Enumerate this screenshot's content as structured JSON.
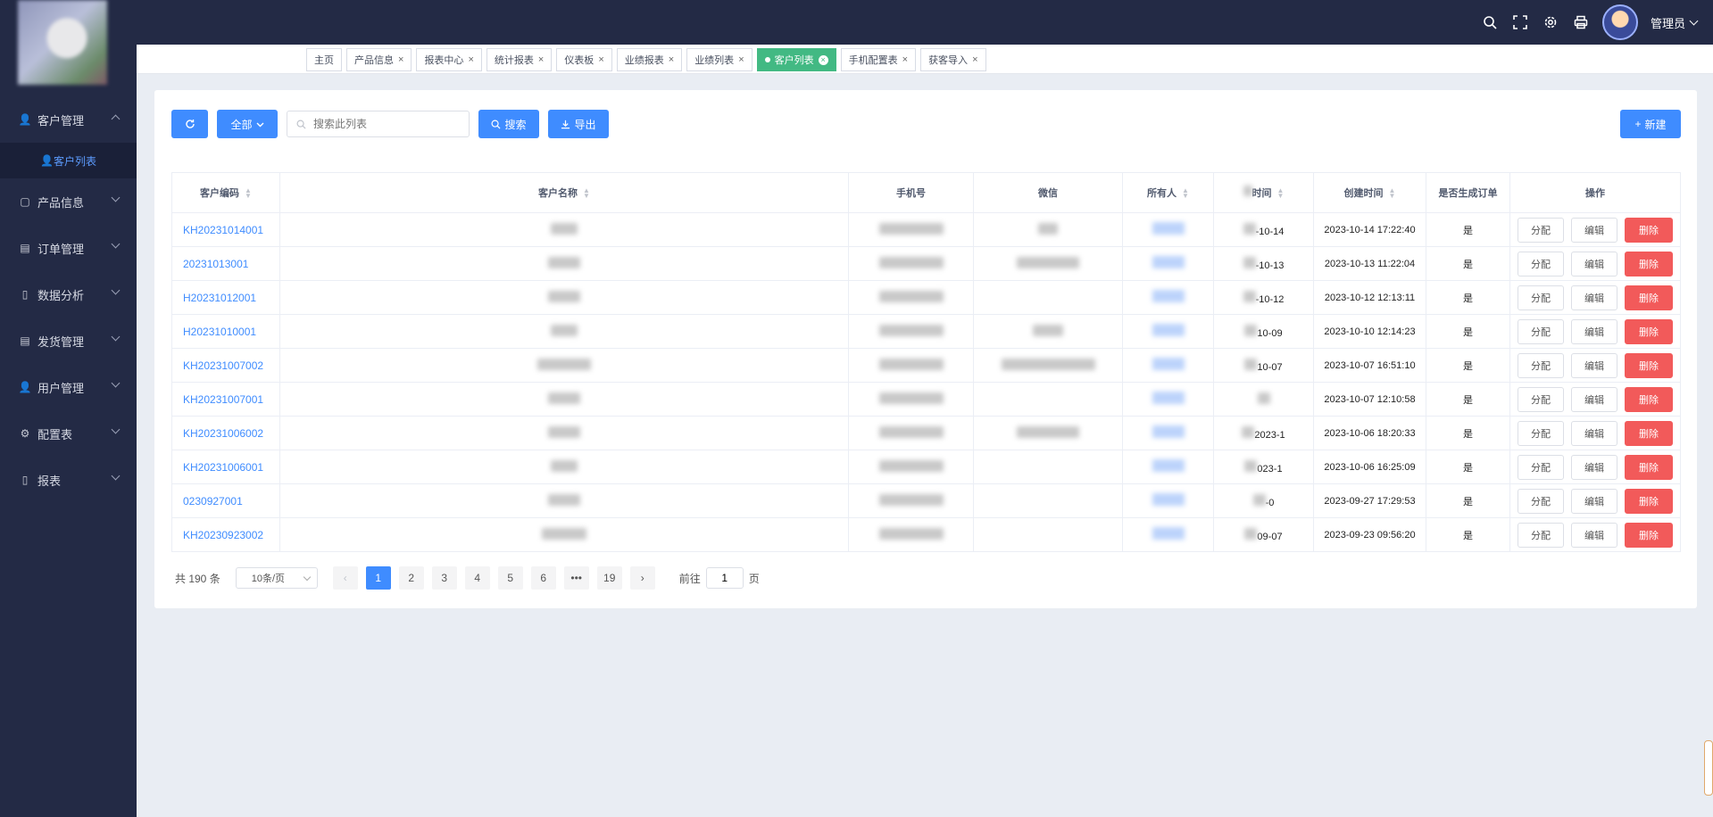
{
  "sidebar": {
    "items": [
      {
        "label": "客户管理",
        "icon": "user-icon",
        "expanded": true
      },
      {
        "label": "产品信息",
        "icon": "product-icon"
      },
      {
        "label": "订单管理",
        "icon": "clipboard-icon"
      },
      {
        "label": "数据分析",
        "icon": "chart-icon"
      },
      {
        "label": "发货管理",
        "icon": "clipboard-icon"
      },
      {
        "label": "用户管理",
        "icon": "user-icon"
      },
      {
        "label": "配置表",
        "icon": "gear-icon"
      },
      {
        "label": "报表",
        "icon": "chart-icon"
      }
    ],
    "sub_item": "客户列表"
  },
  "header": {
    "user": "管理员"
  },
  "tabs": [
    {
      "label": "主页",
      "closable": false
    },
    {
      "label": "产品信息",
      "closable": true
    },
    {
      "label": "报表中心",
      "closable": true
    },
    {
      "label": "统计报表",
      "closable": true
    },
    {
      "label": "仪表板",
      "closable": true
    },
    {
      "label": "业绩报表",
      "closable": true
    },
    {
      "label": "业绩列表",
      "closable": true
    },
    {
      "label": "客户列表",
      "closable": true,
      "active": true
    },
    {
      "label": "手机配置表",
      "closable": true
    },
    {
      "label": "获客导入",
      "closable": true
    }
  ],
  "toolbar": {
    "all_label": "全部",
    "search_placeholder": "搜索此列表",
    "search_label": "搜索",
    "export_label": "导出",
    "new_label": "新建"
  },
  "table": {
    "columns": [
      "客户编码",
      "客户名称",
      "手机号",
      "微信",
      "所有人",
      "时间",
      "创建时间",
      "是否生成订单",
      "操作"
    ],
    "rows": [
      {
        "code": "KH20231014001",
        "follow": "-10-14",
        "created": "2023-10-14 17:22:40",
        "order": "是"
      },
      {
        "code": "20231013001",
        "follow": "-10-13",
        "created": "2023-10-13 11:22:04",
        "order": "是"
      },
      {
        "code": "H20231012001",
        "follow": "-10-12",
        "created": "2023-10-12 12:13:11",
        "order": "是"
      },
      {
        "code": "H20231010001",
        "follow": "10-09",
        "created": "2023-10-10 12:14:23",
        "order": "是"
      },
      {
        "code": "KH20231007002",
        "follow": "10-07",
        "created": "2023-10-07 16:51:10",
        "order": "是"
      },
      {
        "code": "KH20231007001",
        "follow": "",
        "created": "2023-10-07 12:10:58",
        "order": "是"
      },
      {
        "code": "KH20231006002",
        "follow": "2023-1",
        "created": "2023-10-06 18:20:33",
        "order": "是"
      },
      {
        "code": "KH20231006001",
        "follow": "023-1",
        "created": "2023-10-06 16:25:09",
        "order": "是"
      },
      {
        "code": "0230927001",
        "follow": "-0",
        "created": "2023-09-27 17:29:53",
        "order": "是"
      },
      {
        "code": "KH20230923002",
        "follow": "09-07",
        "created": "2023-09-23 09:56:20",
        "order": "是"
      }
    ],
    "actions": {
      "assign": "分配",
      "edit": "编辑",
      "delete": "删除"
    }
  },
  "pagination": {
    "total_text": "共 190 条",
    "page_size": "10条/页",
    "pages": [
      "1",
      "2",
      "3",
      "4",
      "5",
      "6",
      "•••",
      "19"
    ],
    "current": "1",
    "goto_prefix": "前往",
    "goto_value": "1",
    "goto_suffix": "页"
  }
}
